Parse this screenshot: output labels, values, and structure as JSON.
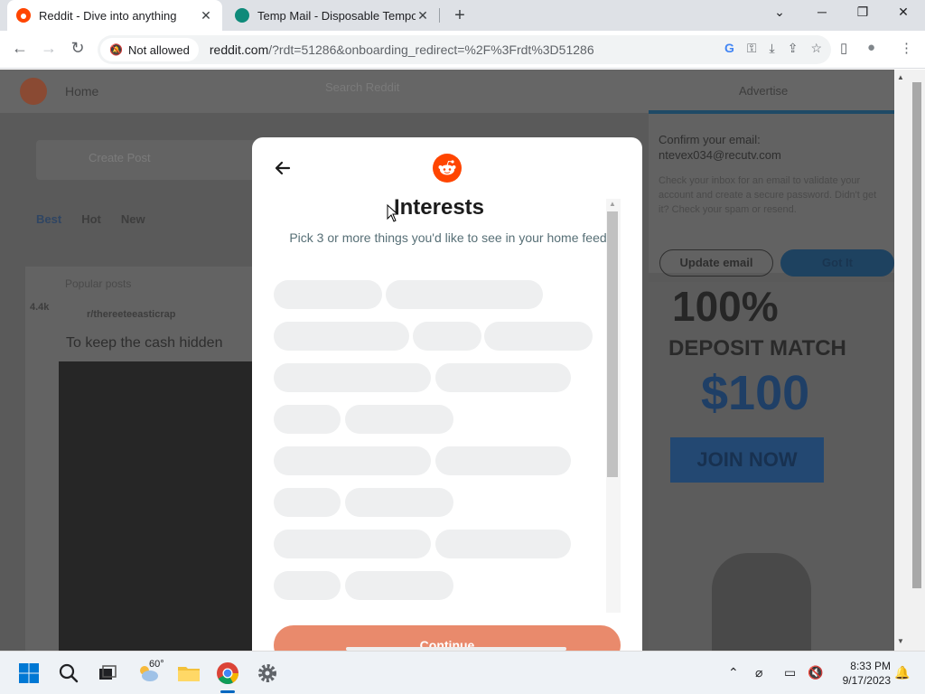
{
  "browser": {
    "tabs": [
      {
        "title": "Reddit - Dive into anything",
        "close": "✕"
      },
      {
        "title": "Temp Mail - Disposable Temporary",
        "close": "✕"
      }
    ],
    "new_tab": "+",
    "window": {
      "minimize": "─",
      "restore": "❐",
      "close": "✕",
      "tab_search": "⌄"
    },
    "site_permission": "Not allowed",
    "url_host": "reddit.com",
    "url_path": "/?rdt=51286&onboarding_redirect=%2F%3Frdt%3D51286",
    "icons": {
      "google": "G",
      "key": "⚿",
      "install": "⤓",
      "share": "⇪",
      "bookmark": "☆",
      "sidepanel": "▯",
      "profile": "●",
      "menu": "⋮"
    }
  },
  "background_page": {
    "nav_home": "Home",
    "search_placeholder": "Search Reddit",
    "advertise": "Advertise",
    "create_post": "Create Post",
    "sort_tabs": [
      "Best",
      "Hot",
      "New"
    ],
    "promoted": "Popular posts",
    "votes": "4.4k",
    "subreddit": "r/thereeteeasticrap",
    "post_title": "To keep the cash hidden",
    "email_popup": {
      "heading": "Confirm your email:",
      "email": "ntevex034@recutv.com",
      "body": "Check your inbox for an email to validate your account and create a secure password. Didn't get it? Check your spam or resend.",
      "update_button": "Update email",
      "got_it_button": "Got It"
    },
    "ad": {
      "big": "100%",
      "deposit": "DEPOSIT MATCH",
      "amount": "$100",
      "join": "JOIN NOW"
    }
  },
  "modal": {
    "title": "Interests",
    "subtitle": "Pick 3 or more things you'd like to see in your home feed",
    "continue_label": "Continue",
    "chips_loading": true,
    "colors": {
      "brand": "#ff4500",
      "continue_disabled": "#e98a6c"
    }
  },
  "taskbar": {
    "weather_temp": "60°",
    "time": "8:33 PM",
    "date": "9/17/2023"
  }
}
